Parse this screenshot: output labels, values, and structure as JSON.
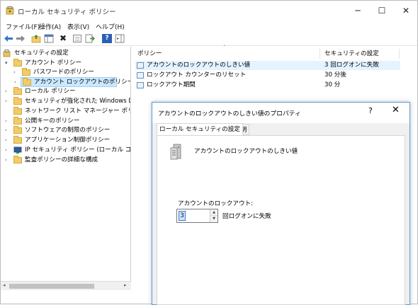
{
  "window": {
    "title": "ローカル セキュリティ ポリシー",
    "controls": {
      "minimize": "─",
      "maximize": "☐",
      "close": "✕"
    }
  },
  "menu": [
    "ファイル(F)",
    "操作(A)",
    "表示(V)",
    "ヘルプ(H)"
  ],
  "toolbar": {
    "icons": [
      "back-arrow-icon",
      "forward-arrow-icon",
      "up-folder-icon",
      "show-hide-tree-icon",
      "delete-icon",
      "properties-icon",
      "refresh-icon",
      "export-list-icon",
      "help-icon",
      "action-pane-icon"
    ],
    "delete_glyph": "✖",
    "help_glyph": "?"
  },
  "tree": {
    "expanded_arrow": "▾",
    "collapsed_arrow": "›",
    "root": "セキュリティの設定",
    "items": [
      {
        "label": "アカウント ポリシー",
        "state": "expanded"
      },
      {
        "label": "パスワードのポリシー",
        "state": "collapsed"
      },
      {
        "label": "アカウント ロックアウトのポリシー",
        "state": "selected"
      },
      {
        "label": "ローカル ポリシー",
        "state": "collapsed"
      },
      {
        "label": "セキュリティが強化された Windows Defen",
        "state": "collapsed"
      },
      {
        "label": "ネットワーク リスト マネージャー ポリシー",
        "state": "none"
      },
      {
        "label": "公開キーのポリシー",
        "state": "collapsed"
      },
      {
        "label": "ソフトウェアの制限のポリシー",
        "state": "collapsed"
      },
      {
        "label": "アプリケーション制御ポリシー",
        "state": "collapsed"
      },
      {
        "label": "IP セキュリティ ポリシー (ローカル コンピューター",
        "state": "collapsed"
      },
      {
        "label": "監査ポリシーの詳細な構成",
        "state": "collapsed"
      }
    ]
  },
  "list": {
    "columns": [
      "ポリシー",
      "セキュリティの設定"
    ],
    "sort_glyph": "˄",
    "rows": [
      {
        "policy": "アカウントのロックアウトのしきい値",
        "setting": "3 回ログオンに失敗"
      },
      {
        "policy": "ロックアウト カウンターのリセット",
        "setting": "30 分後"
      },
      {
        "policy": "ロックアウト期間",
        "setting": "30 分"
      }
    ]
  },
  "dialog": {
    "title": "アカウントのロックアウトのしきい値のプロパティ",
    "help_glyph": "?",
    "close_glyph": "✕",
    "tabs": [
      "ローカル セキュリティの設定",
      "説明"
    ],
    "heading": "アカウントのロックアウトのしきい値",
    "lockout_label": "アカウントのロックアウト:",
    "lockout_value": "3",
    "lockout_suffix": "回ログオンに失敗",
    "spin_up_glyph": "▲",
    "spin_down_glyph": "▼"
  },
  "scrollbar": {
    "left_glyph": "◂",
    "right_glyph": "▸"
  },
  "colors": {
    "selection": "#cce8ff",
    "row_highlight": "#e5f3ff",
    "dialog_border": "#5b9bd5",
    "folder": "#f3cc6a"
  }
}
